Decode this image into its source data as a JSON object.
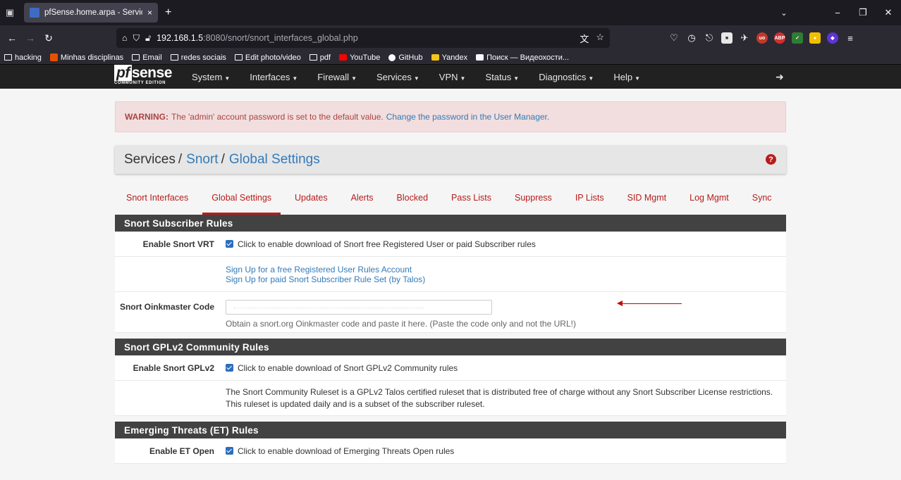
{
  "browser": {
    "tab_title": "pfSense.home.arpa - Services: S",
    "tab_close": "×",
    "new_tab": "+",
    "url_host": "192.168.1.5",
    "url_path": ":8080/snort/snort_interfaces_global.php",
    "bookmarks": [
      "hacking",
      "Minhas disciplinas",
      "Email",
      "redes sociais",
      "Edit photo/video",
      "pdf",
      "YouTube",
      "GitHub",
      "Yandex",
      "Поиск — Видеохости..."
    ]
  },
  "pfsense": {
    "logo_word": "sense",
    "logo_pf": "pf",
    "logo_edition": "COMMUNITY EDITION",
    "menu": [
      "System",
      "Interfaces",
      "Firewall",
      "Services",
      "VPN",
      "Status",
      "Diagnostics",
      "Help"
    ]
  },
  "alert": {
    "label": "WARNING:",
    "text": "The 'admin' account password is set to the default value.",
    "link": "Change the password in the User Manager."
  },
  "breadcrumb": {
    "root": "Services",
    "sep": "/",
    "level1": "Snort",
    "level2": "Global Settings",
    "help": "?"
  },
  "tabs": [
    "Snort Interfaces",
    "Global Settings",
    "Updates",
    "Alerts",
    "Blocked",
    "Pass Lists",
    "Suppress",
    "IP Lists",
    "SID Mgmt",
    "Log Mgmt",
    "Sync"
  ],
  "active_tab": "Global Settings",
  "sections": {
    "subscriber": {
      "title": "Snort Subscriber Rules",
      "enable_label": "Enable Snort VRT",
      "enable_text": "Click to enable download of Snort free Registered User or paid Subscriber rules",
      "signup_free": "Sign Up for a free Registered User Rules Account",
      "signup_paid": "Sign Up for paid Snort Subscriber Rule Set (by Talos)",
      "oink_label": "Snort Oinkmaster Code",
      "oink_value": "",
      "oink_hint": "Obtain a snort.org Oinkmaster code and paste it here. (Paste the code only and not the URL!)"
    },
    "gplv2": {
      "title": "Snort GPLv2 Community Rules",
      "enable_label": "Enable Snort GPLv2",
      "enable_text": "Click to enable download of Snort GPLv2 Community rules",
      "description": "The Snort Community Ruleset is a GPLv2 Talos certified ruleset that is distributed free of charge without any Snort Subscriber License restrictions. This ruleset is updated daily and is a subset of the subscriber ruleset."
    },
    "et": {
      "title": "Emerging Threats (ET) Rules",
      "enable_label": "Enable ET Open",
      "enable_text": "Click to enable download of Emerging Threats Open rules"
    }
  },
  "colors": {
    "accent": "#b71c1c",
    "link": "#337ab7",
    "panel_head": "#424242",
    "alert_bg": "#f2dede"
  }
}
